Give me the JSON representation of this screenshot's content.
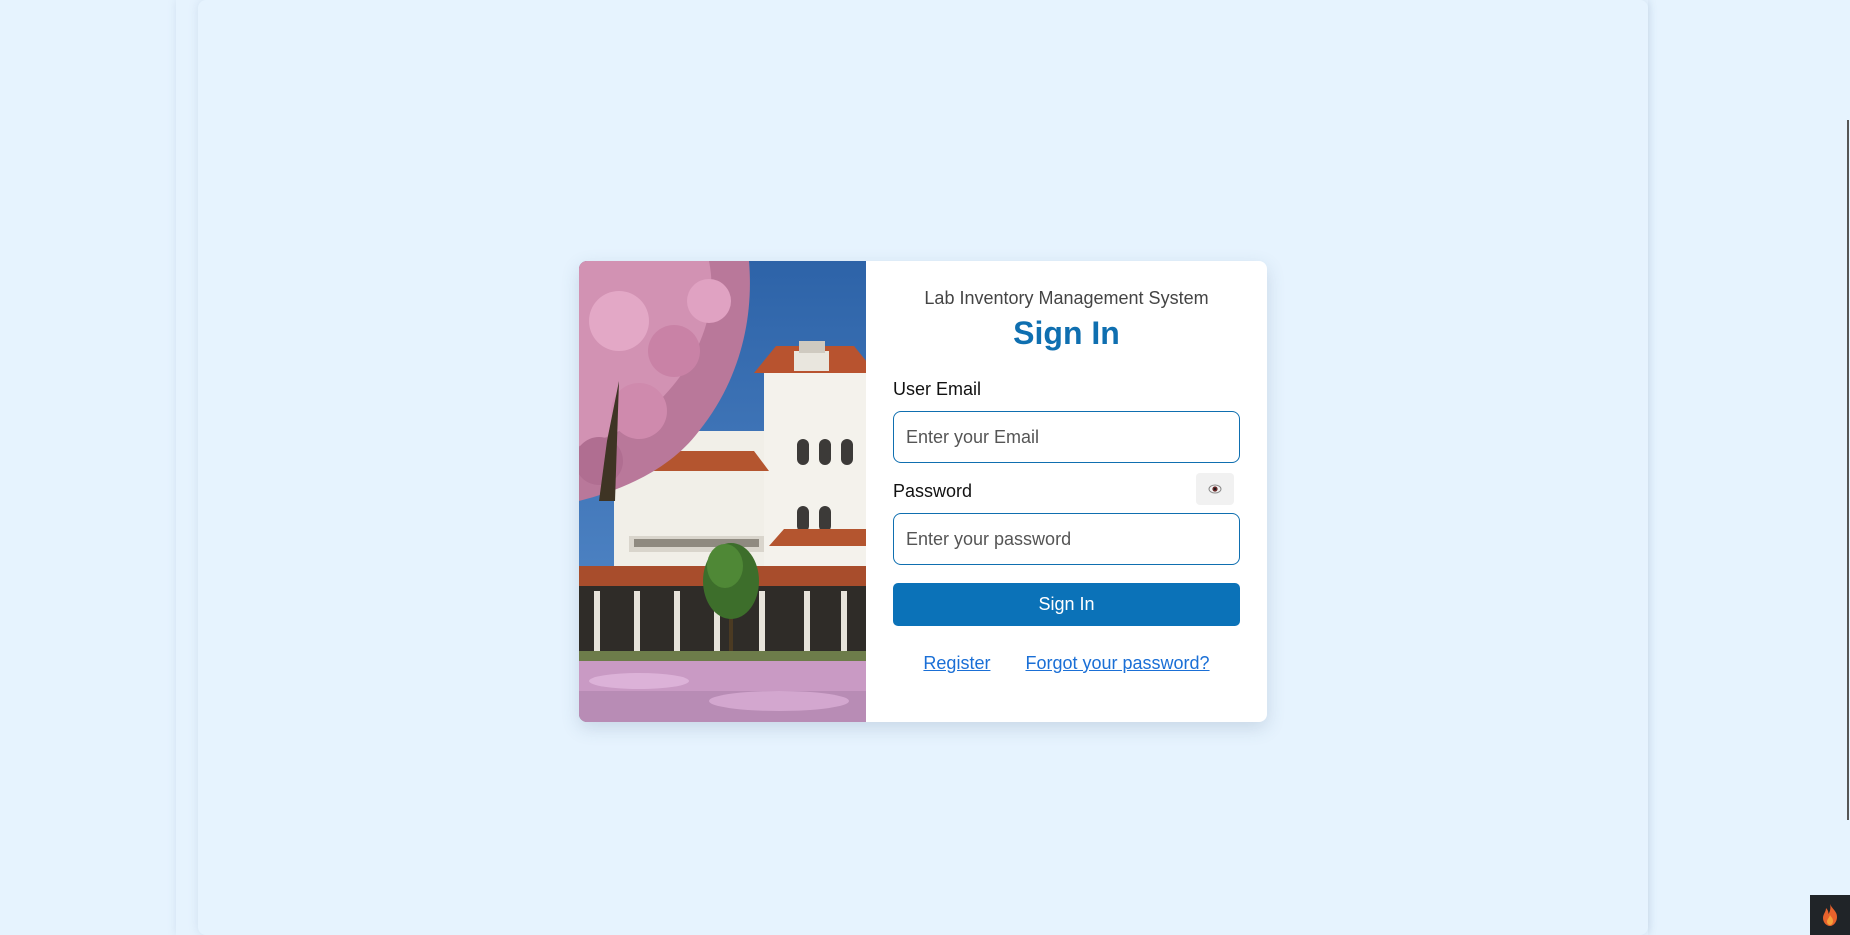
{
  "login": {
    "system_name": "Lab Inventory Management System",
    "title": "Sign In",
    "email_label": "User Email",
    "email_placeholder": "Enter your Email",
    "email_value": "",
    "password_label": "Password",
    "password_placeholder": "Enter your password",
    "password_value": "",
    "password_toggle_icon": "eye-icon",
    "submit_label": "Sign In",
    "register_link": "Register",
    "forgot_link": "Forgot your password?"
  },
  "corner_widget": {
    "icon": "flame-icon"
  },
  "colors": {
    "background": "#e6f3fe",
    "accent": "#0b72b8",
    "title": "#0f6fb0",
    "link": "#1a6fd6"
  }
}
